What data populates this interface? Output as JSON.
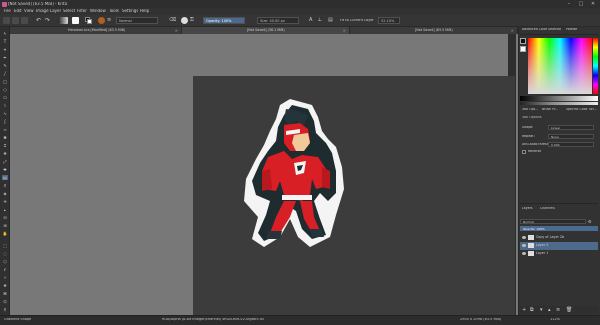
{
  "window": {
    "title": "[Not Saved] [63.5 MiB] - Krita",
    "controls": [
      "minimize-icon",
      "maximize-icon",
      "close-icon"
    ]
  },
  "menu": [
    "File",
    "Edit",
    "View",
    "Image",
    "Layer",
    "Select",
    "Filter",
    "Window",
    "Tools",
    "Settings",
    "Help"
  ],
  "toolbar": {
    "blend_mode": "Normal",
    "opacity": "Opacity: 100%",
    "size": "Size: 40.00 px",
    "fit_label": "Fit to Current Layer",
    "zoom": "52.10%"
  },
  "tabs": [
    {
      "label": "Heroman.kra [Modified] (63.5 MiB)",
      "active": false
    },
    {
      "label": "[Not Saved] (38.1 MiB)",
      "active": true
    },
    {
      "label": "[Not Saved] (63.5 MiB)",
      "active": false
    }
  ],
  "dock": {
    "color_tabs": [
      "Advanced Color Selector",
      "Palette"
    ],
    "mini_tabs": [
      "Tool Opt...",
      "Brush Pr...",
      "Specific Color Sel..."
    ],
    "tool_options_title": "Tool Options",
    "options": [
      {
        "label": "Shape:",
        "value": "Linear"
      },
      {
        "label": "Repeat:",
        "value": "None"
      },
      {
        "label": "Anti-alias threshold:",
        "value": "0.000"
      },
      {
        "label": "Reverse",
        "value": ""
      }
    ],
    "layers_tabs": [
      "Layers",
      "Channels"
    ],
    "blend": "Normal",
    "opacity": "Opacity: 100%",
    "layers": [
      {
        "name": "Copy of Layer 2b",
        "selected": false
      },
      {
        "name": "Layer 2",
        "selected": true
      },
      {
        "name": "Layer 1",
        "selected": false
      }
    ]
  },
  "status": {
    "tool": "Gradient Shape",
    "color": "RGB/Alpha (8-bit integer/channel) sRGB-elle-V2-srgbtrc.icc",
    "size": "2905 x 2098 (63.5 MiB)",
    "zoom": "112%"
  }
}
